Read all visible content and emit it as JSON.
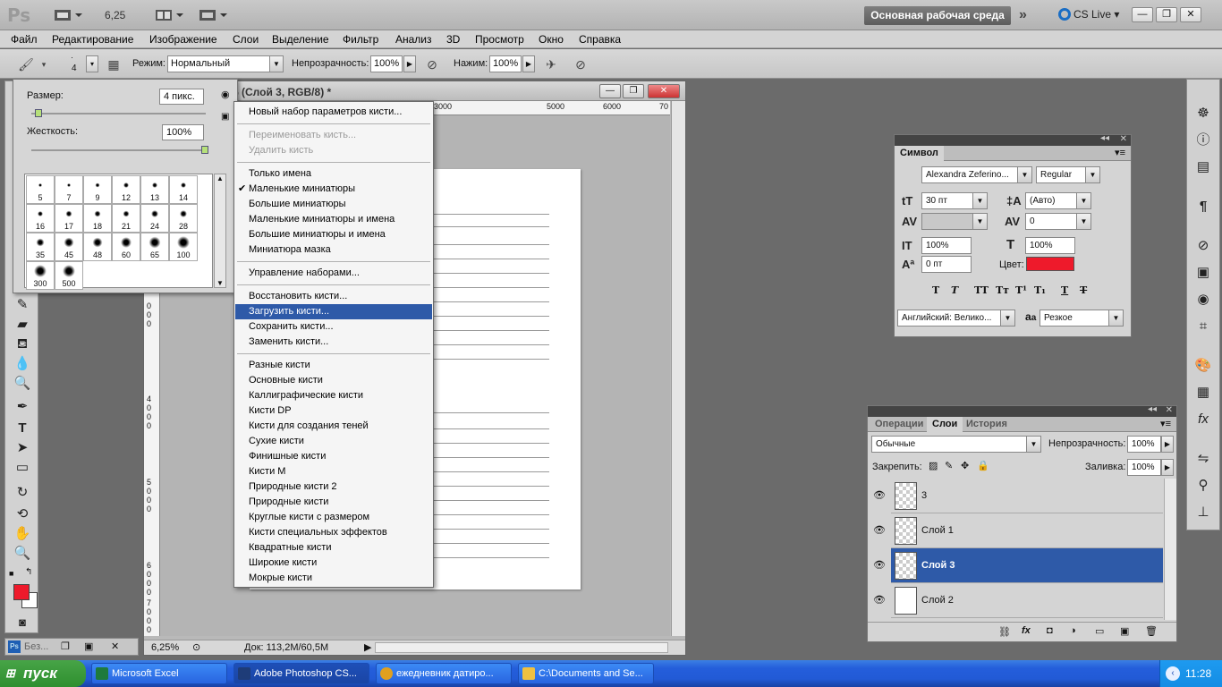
{
  "app": {
    "logo": "Ps",
    "zoom": "6,25",
    "workspace": "Основная рабочая среда",
    "more": "»",
    "cslive": "CS Live"
  },
  "menu": [
    "Файл",
    "Редактирование",
    "Изображение",
    "Слои",
    "Выделение",
    "Фильтр",
    "Анализ",
    "3D",
    "Просмотр",
    "Окно",
    "Справка"
  ],
  "options": {
    "brush_size": "4",
    "mode_label": "Режим:",
    "mode_value": "Нормальный",
    "opacity_label": "Непрозрачность:",
    "opacity_value": "100%",
    "pressure_label": "Нажим:",
    "pressure_value": "100%"
  },
  "brush_panel": {
    "size_label": "Размер:",
    "size_value": "4 пикс.",
    "size_fraction": 0.02,
    "hardness_label": "Жесткость:",
    "hardness_value": "100%",
    "hardness_fraction": 1.0,
    "brushes": [
      "5",
      "7",
      "9",
      "12",
      "13",
      "14",
      "16",
      "17",
      "18",
      "21",
      "24",
      "28",
      "35",
      "45",
      "48",
      "60",
      "65",
      "100",
      "300",
      "500"
    ]
  },
  "document": {
    "title": "% (Слой 3, RGB/8) *",
    "ruler_h": [
      "3000",
      "5000",
      "6000",
      "70"
    ],
    "ruler_v": [
      "0",
      "0",
      "0",
      "4",
      "0",
      "0",
      "0",
      "5",
      "0",
      "0",
      "0",
      "6",
      "0",
      "0",
      "0",
      "7",
      "0",
      "0",
      "0"
    ],
    "status_zoom": "6,25%",
    "status_doc": "Док: 113,2М/60,5М"
  },
  "context_menu": {
    "items": [
      {
        "label": "Новый набор параметров кисти...",
        "state": "normal"
      },
      {
        "sep": true
      },
      {
        "label": "Переименовать кисть...",
        "state": "disabled"
      },
      {
        "label": "Удалить кисть",
        "state": "disabled"
      },
      {
        "sep": true
      },
      {
        "label": "Только имена",
        "state": "normal"
      },
      {
        "label": "Маленькие миниатюры",
        "state": "checked"
      },
      {
        "label": "Большие миниатюры",
        "state": "normal"
      },
      {
        "label": "Маленькие миниатюры и имена",
        "state": "normal"
      },
      {
        "label": "Большие миниатюры и имена",
        "state": "normal"
      },
      {
        "label": "Миниатюра мазка",
        "state": "normal"
      },
      {
        "sep": true
      },
      {
        "label": "Управление наборами...",
        "state": "normal"
      },
      {
        "sep": true
      },
      {
        "label": "Восстановить кисти...",
        "state": "normal"
      },
      {
        "label": "Загрузить кисти...",
        "state": "selected"
      },
      {
        "label": "Сохранить кисти...",
        "state": "normal"
      },
      {
        "label": "Заменить кисти...",
        "state": "normal"
      },
      {
        "sep": true
      },
      {
        "label": "Разные кисти",
        "state": "normal"
      },
      {
        "label": "Основные кисти",
        "state": "normal"
      },
      {
        "label": "Каллиграфические кисти",
        "state": "normal"
      },
      {
        "label": "Кисти DP",
        "state": "normal"
      },
      {
        "label": "Кисти для создания теней",
        "state": "normal"
      },
      {
        "label": "Сухие кисти",
        "state": "normal"
      },
      {
        "label": "Финишные кисти",
        "state": "normal"
      },
      {
        "label": "Кисти M",
        "state": "normal"
      },
      {
        "label": "Природные кисти 2",
        "state": "normal"
      },
      {
        "label": "Природные кисти",
        "state": "normal"
      },
      {
        "label": "Круглые кисти с размером",
        "state": "normal"
      },
      {
        "label": "Кисти специальных эффектов",
        "state": "normal"
      },
      {
        "label": "Квадратные кисти",
        "state": "normal"
      },
      {
        "label": "Широкие кисти",
        "state": "normal"
      },
      {
        "label": "Мокрые кисти",
        "state": "normal"
      }
    ]
  },
  "char_panel": {
    "tab": "Символ",
    "font_family": "Alexandra Zeferino...",
    "font_style": "Regular",
    "font_size": "30 пт",
    "leading": "(Авто)",
    "kerning": "",
    "tracking": "0",
    "vscale": "100%",
    "hscale": "100%",
    "baseline": "0 пт",
    "color_label": "Цвет:",
    "color": "#ee1a2b",
    "styles": [
      "T",
      "T",
      "TT",
      "Tт",
      "T¹",
      "T₁",
      "T",
      "T"
    ],
    "language": "Английский: Велико...",
    "aa_label": "a",
    "aa_value": "Резкое"
  },
  "layers_panel": {
    "tabs": [
      "Операции",
      "Слои",
      "История"
    ],
    "active_tab": "Слои",
    "blend_mode": "Обычные",
    "opacity_label": "Непрозрачность:",
    "opacity_value": "100%",
    "lock_label": "Закрепить:",
    "fill_label": "Заливка:",
    "fill_value": "100%",
    "layers": [
      {
        "name": "3",
        "selected": false,
        "thumb": "transparent"
      },
      {
        "name": "Слой 1",
        "selected": false,
        "thumb": "transparent"
      },
      {
        "name": "Слой 3",
        "selected": true,
        "thumb": "transparent"
      },
      {
        "name": "Слой 2",
        "selected": false,
        "thumb": "white"
      }
    ]
  },
  "mini_doc": {
    "label": "Без..."
  },
  "taskbar": {
    "start": "пуск",
    "tasks": [
      {
        "label": "Microsoft Excel",
        "active": false
      },
      {
        "label": "Adobe Photoshop CS...",
        "active": true
      },
      {
        "label": "ежедневник датиро...",
        "active": false
      },
      {
        "label": "C:\\Documents and Se...",
        "active": false
      }
    ],
    "clock": "11:28"
  }
}
